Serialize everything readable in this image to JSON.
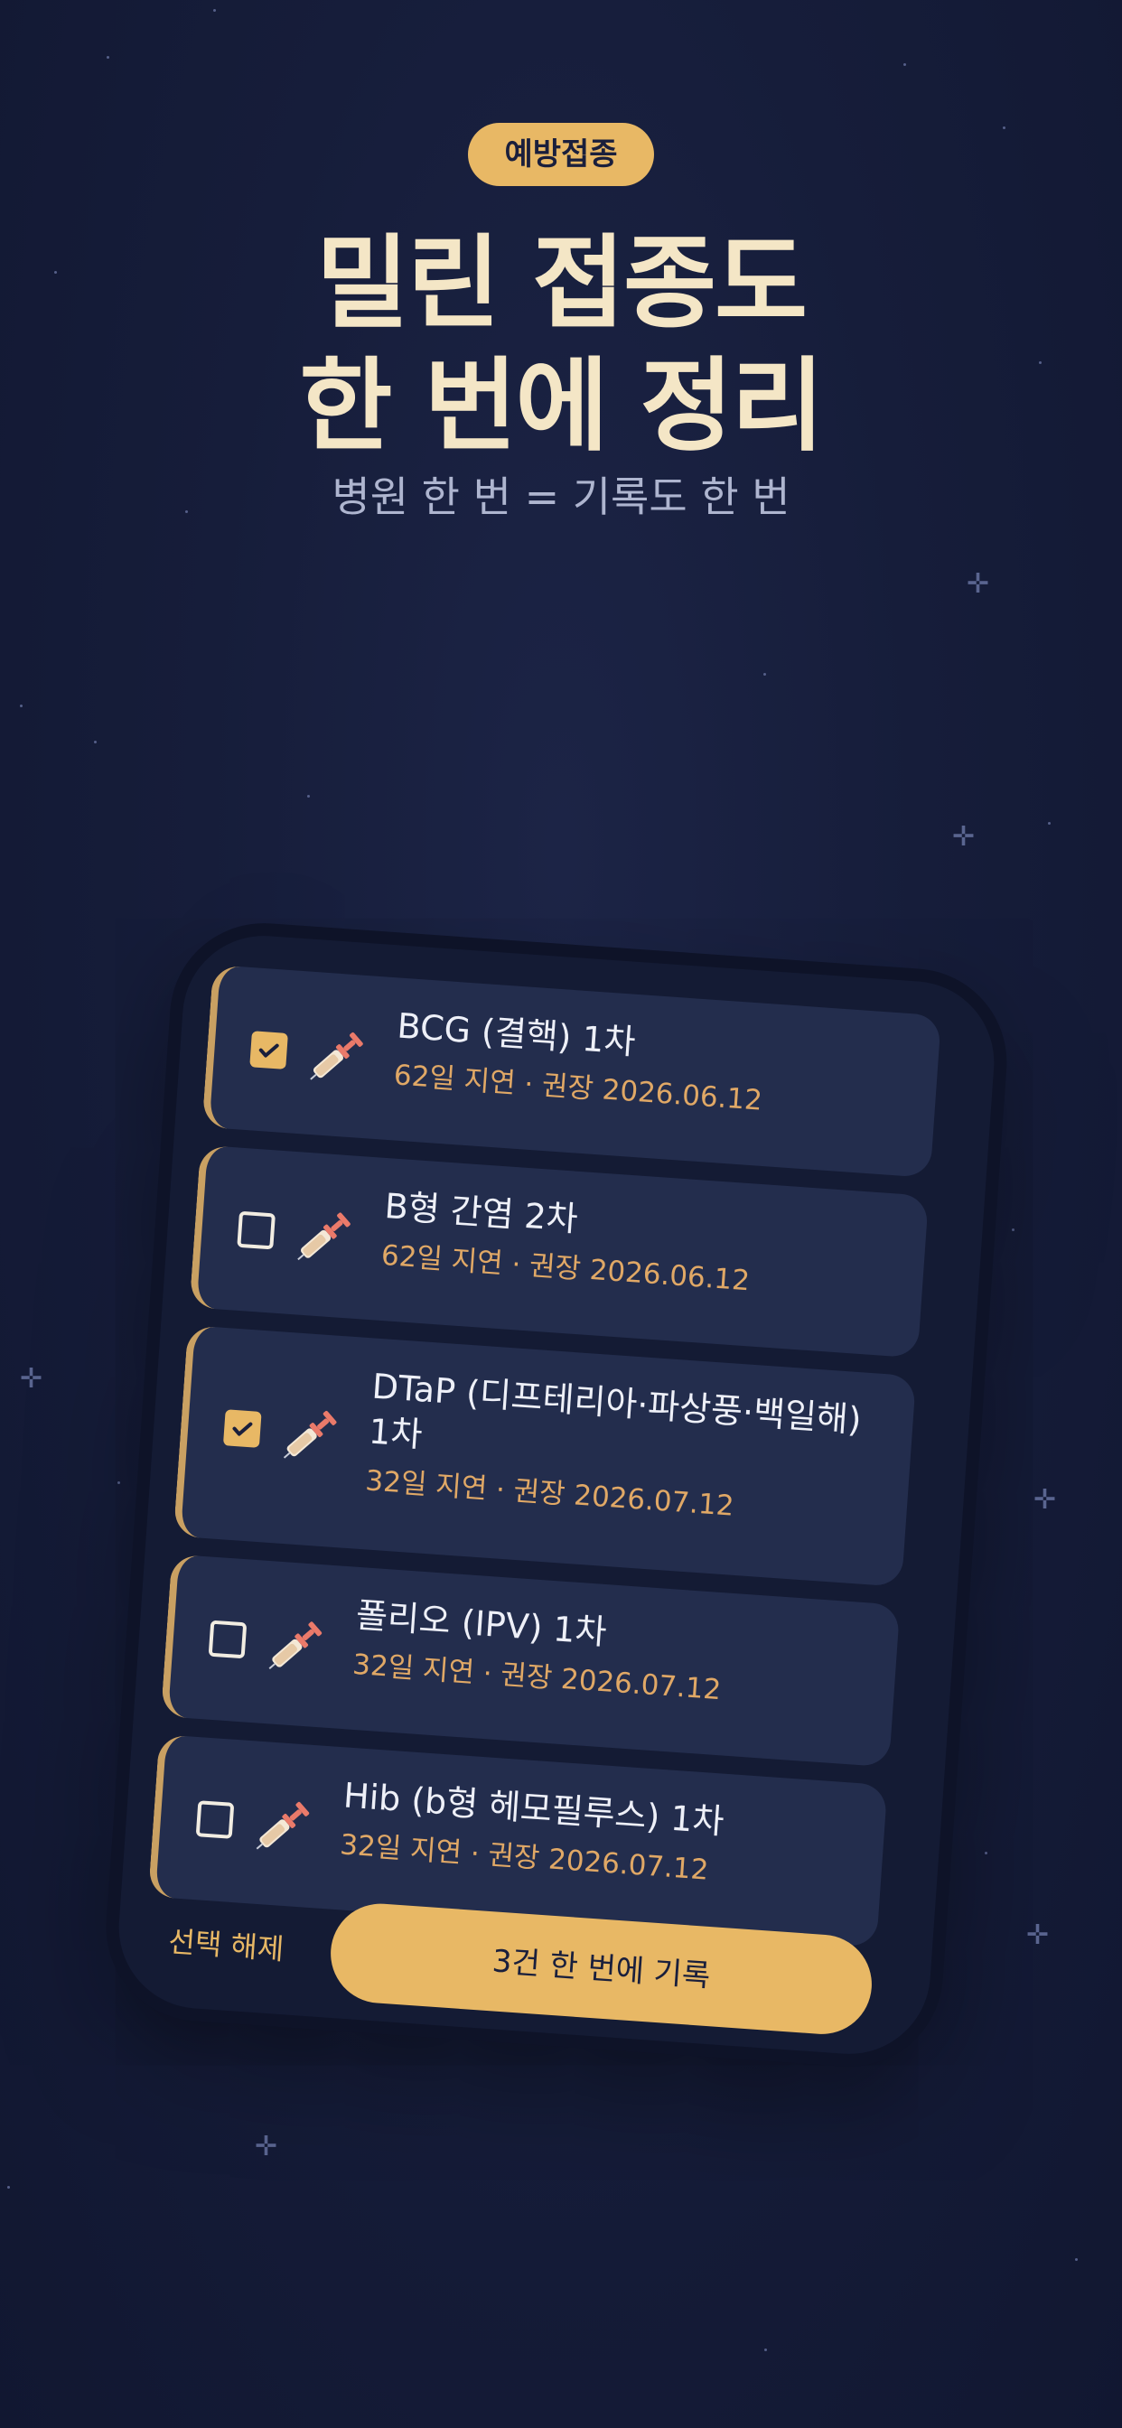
{
  "badge": "예방접종",
  "headline": {
    "line1": "밀린 접종도",
    "line2": "한 번에 정리"
  },
  "subline": "병원 한 번 = 기록도 한 번",
  "vaccines": [
    {
      "title": "BCG (결핵) 1차",
      "meta": "62일 지연 · 권장 2026.06.12",
      "checked": true
    },
    {
      "title": "B형 간염 2차",
      "meta": "62일 지연 · 권장 2026.06.12",
      "checked": false
    },
    {
      "title": "DTaP (디프테리아·파상풍·백일해) 1차",
      "meta": "32일 지연 · 권장 2026.07.12",
      "checked": true
    },
    {
      "title": "폴리오 (IPV) 1차",
      "meta": "32일 지연 · 권장 2026.07.12",
      "checked": false
    },
    {
      "title": "Hib (b형 헤모필루스) 1차",
      "meta": "32일 지연 · 권장 2026.07.12",
      "checked": false
    }
  ],
  "footer": {
    "clear_label": "선택 해제",
    "record_label": "3건 한 번에 기록"
  },
  "colors": {
    "accent": "#e8b865",
    "background": "#161d3a",
    "card": "#232d4d",
    "meta": "#e0a866"
  },
  "icons": {
    "vaccine": "syringe-icon",
    "checked": "checkbox-checked-icon",
    "unchecked": "checkbox-empty-icon"
  }
}
